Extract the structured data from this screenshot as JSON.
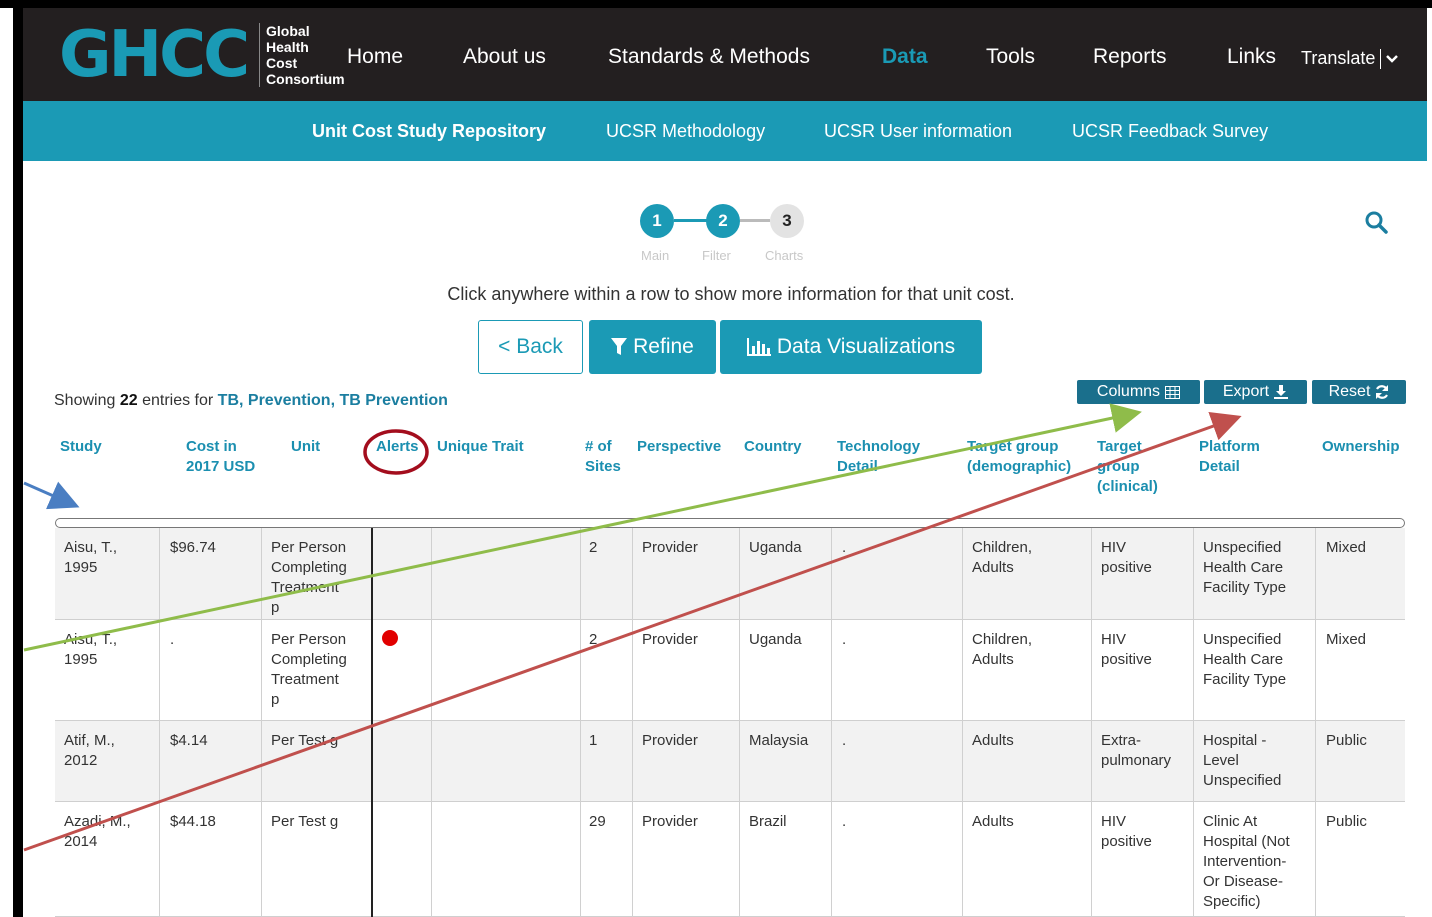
{
  "logo": {
    "mark": "GHCC",
    "lines": [
      "Global",
      "Health",
      "Cost",
      "Consortium"
    ]
  },
  "nav": {
    "items": [
      "Home",
      "About us",
      "Standards & Methods",
      "Data",
      "Tools",
      "Reports",
      "Links"
    ],
    "active": "Data",
    "translate": "Translate"
  },
  "subnav": {
    "items": [
      "Unit Cost Study Repository",
      "UCSR Methodology",
      "UCSR User information",
      "UCSR Feedback Survey"
    ]
  },
  "stepper": {
    "steps": [
      {
        "num": "1",
        "label": "Main",
        "state": "done"
      },
      {
        "num": "2",
        "label": "Filter",
        "state": "done"
      },
      {
        "num": "3",
        "label": "Charts",
        "state": "todo"
      }
    ]
  },
  "instruction": "Click anywhere within a row to show more information for that unit cost.",
  "buttons": {
    "back": "< Back",
    "refine": "Refine",
    "viz": "Data Visualizations",
    "columns": "Columns",
    "export": "Export",
    "reset": "Reset"
  },
  "showing": {
    "prefix": "Showing",
    "count": "22",
    "middle": "entries for",
    "filter": "TB, Prevention, TB Prevention"
  },
  "table": {
    "headers": {
      "study": "Study",
      "cost": [
        "Cost in",
        "2017 USD"
      ],
      "unit": "Unit",
      "alerts": "Alerts",
      "unique": "Unique Trait",
      "sites": [
        "# of",
        "Sites"
      ],
      "perspective": "Perspective",
      "country": "Country",
      "tech": [
        "Technology",
        "Detail"
      ],
      "tgdemo": [
        "Target group",
        "(demographic)"
      ],
      "tgclin": [
        "Target",
        "group",
        "(clinical)"
      ],
      "platform": [
        "Platform",
        "Detail"
      ],
      "ownership": "Ownership"
    },
    "rows": [
      {
        "study": [
          "Aisu, T.,",
          "1995"
        ],
        "cost": "$96.74",
        "unit": [
          "Per Person",
          "Completing",
          "Treatment",
          "p"
        ],
        "alert": false,
        "sites": "2",
        "perspective": "Provider",
        "country": "Uganda",
        "tech": ".",
        "tgdemo": [
          "Children,",
          "Adults"
        ],
        "tgclin": [
          "HIV",
          "positive"
        ],
        "platform": [
          "Unspecified",
          "Health Care",
          "Facility Type"
        ],
        "ownership": "Mixed"
      },
      {
        "study": [
          "Aisu, T.,",
          "1995"
        ],
        "cost": ".",
        "unit": [
          "Per Person",
          "Completing",
          "Treatment",
          "p"
        ],
        "alert": true,
        "sites": "2",
        "perspective": "Provider",
        "country": "Uganda",
        "tech": ".",
        "tgdemo": [
          "Children,",
          "Adults"
        ],
        "tgclin": [
          "HIV",
          "positive"
        ],
        "platform": [
          "Unspecified",
          "Health Care",
          "Facility Type"
        ],
        "ownership": "Mixed"
      },
      {
        "study": [
          "Atif, M.,",
          "2012"
        ],
        "cost": "$4.14",
        "unit": [
          "Per Test g"
        ],
        "alert": false,
        "sites": "1",
        "perspective": "Provider",
        "country": "Malaysia",
        "tech": ".",
        "tgdemo": [
          "Adults"
        ],
        "tgclin": [
          "Extra-",
          "pulmonary"
        ],
        "platform": [
          "Hospital -",
          "Level",
          "Unspecified"
        ],
        "ownership": "Public"
      },
      {
        "study": [
          "Azadi, M.,",
          "2014"
        ],
        "cost": "$44.18",
        "unit": [
          "Per Test g"
        ],
        "alert": false,
        "sites": "29",
        "perspective": "Provider",
        "country": "Brazil",
        "tech": ".",
        "tgdemo": [
          "Adults"
        ],
        "tgclin": [
          "HIV",
          "positive"
        ],
        "platform": [
          "Clinic At",
          "Hospital (Not",
          "Intervention-",
          "Or Disease-",
          "Specific)"
        ],
        "ownership": "Public"
      }
    ]
  },
  "colors": {
    "brand": "#1b9ab5",
    "nav_bg": "#231f20",
    "annot_blue": "#4a7ec2",
    "annot_green": "#8fbc4a",
    "annot_red": "#c0504d",
    "alert_red": "#e10000"
  }
}
